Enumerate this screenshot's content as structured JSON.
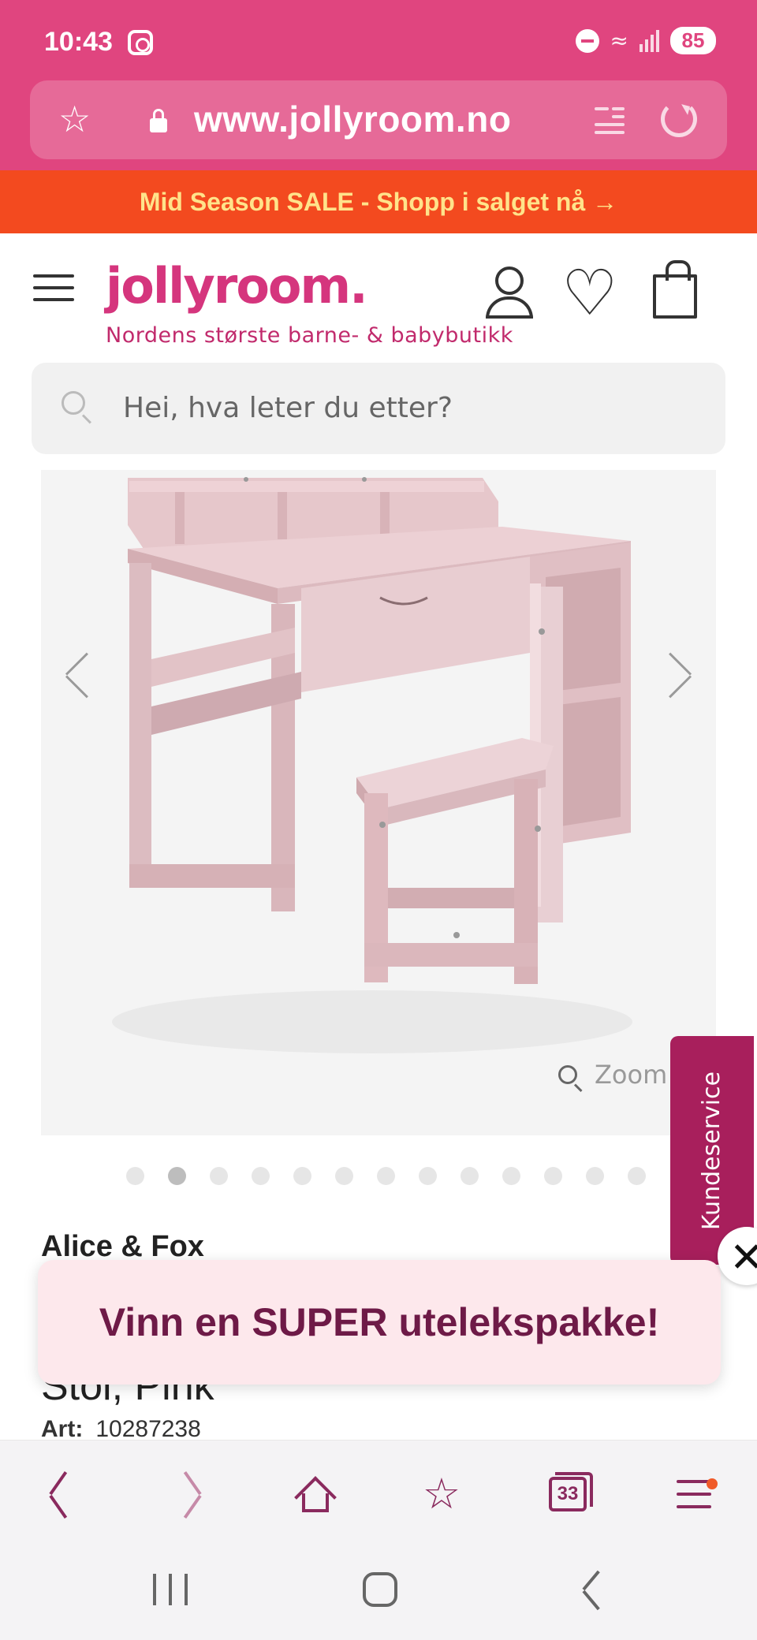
{
  "status_bar": {
    "time": "10:43",
    "battery": "85"
  },
  "browser": {
    "url": "www.jollyroom.no",
    "tab_count": "33"
  },
  "promo": {
    "text": "Mid Season SALE - Shopp i salget nå →"
  },
  "header": {
    "logo": "jollyroom.",
    "tagline": "Nordens største barne- & babybutikk"
  },
  "search": {
    "placeholder": "Hei, hva leter du etter?"
  },
  "gallery": {
    "zoom_label": "Zoom",
    "image_count": 13,
    "active_index": 1
  },
  "product": {
    "brand": "Alice & Fox",
    "title_fragment": "Stol, Pink",
    "art_label": "Art:",
    "art_number": "10287238"
  },
  "side_tab": {
    "label": "Kundeservice"
  },
  "popup": {
    "text": "Vinn en SUPER utelekspakke!"
  },
  "colors": {
    "brand_pink": "#e0457f",
    "promo_orange": "#f34a1f",
    "accent_magenta": "#a81f5c",
    "popup_bg": "#fde8ec"
  }
}
